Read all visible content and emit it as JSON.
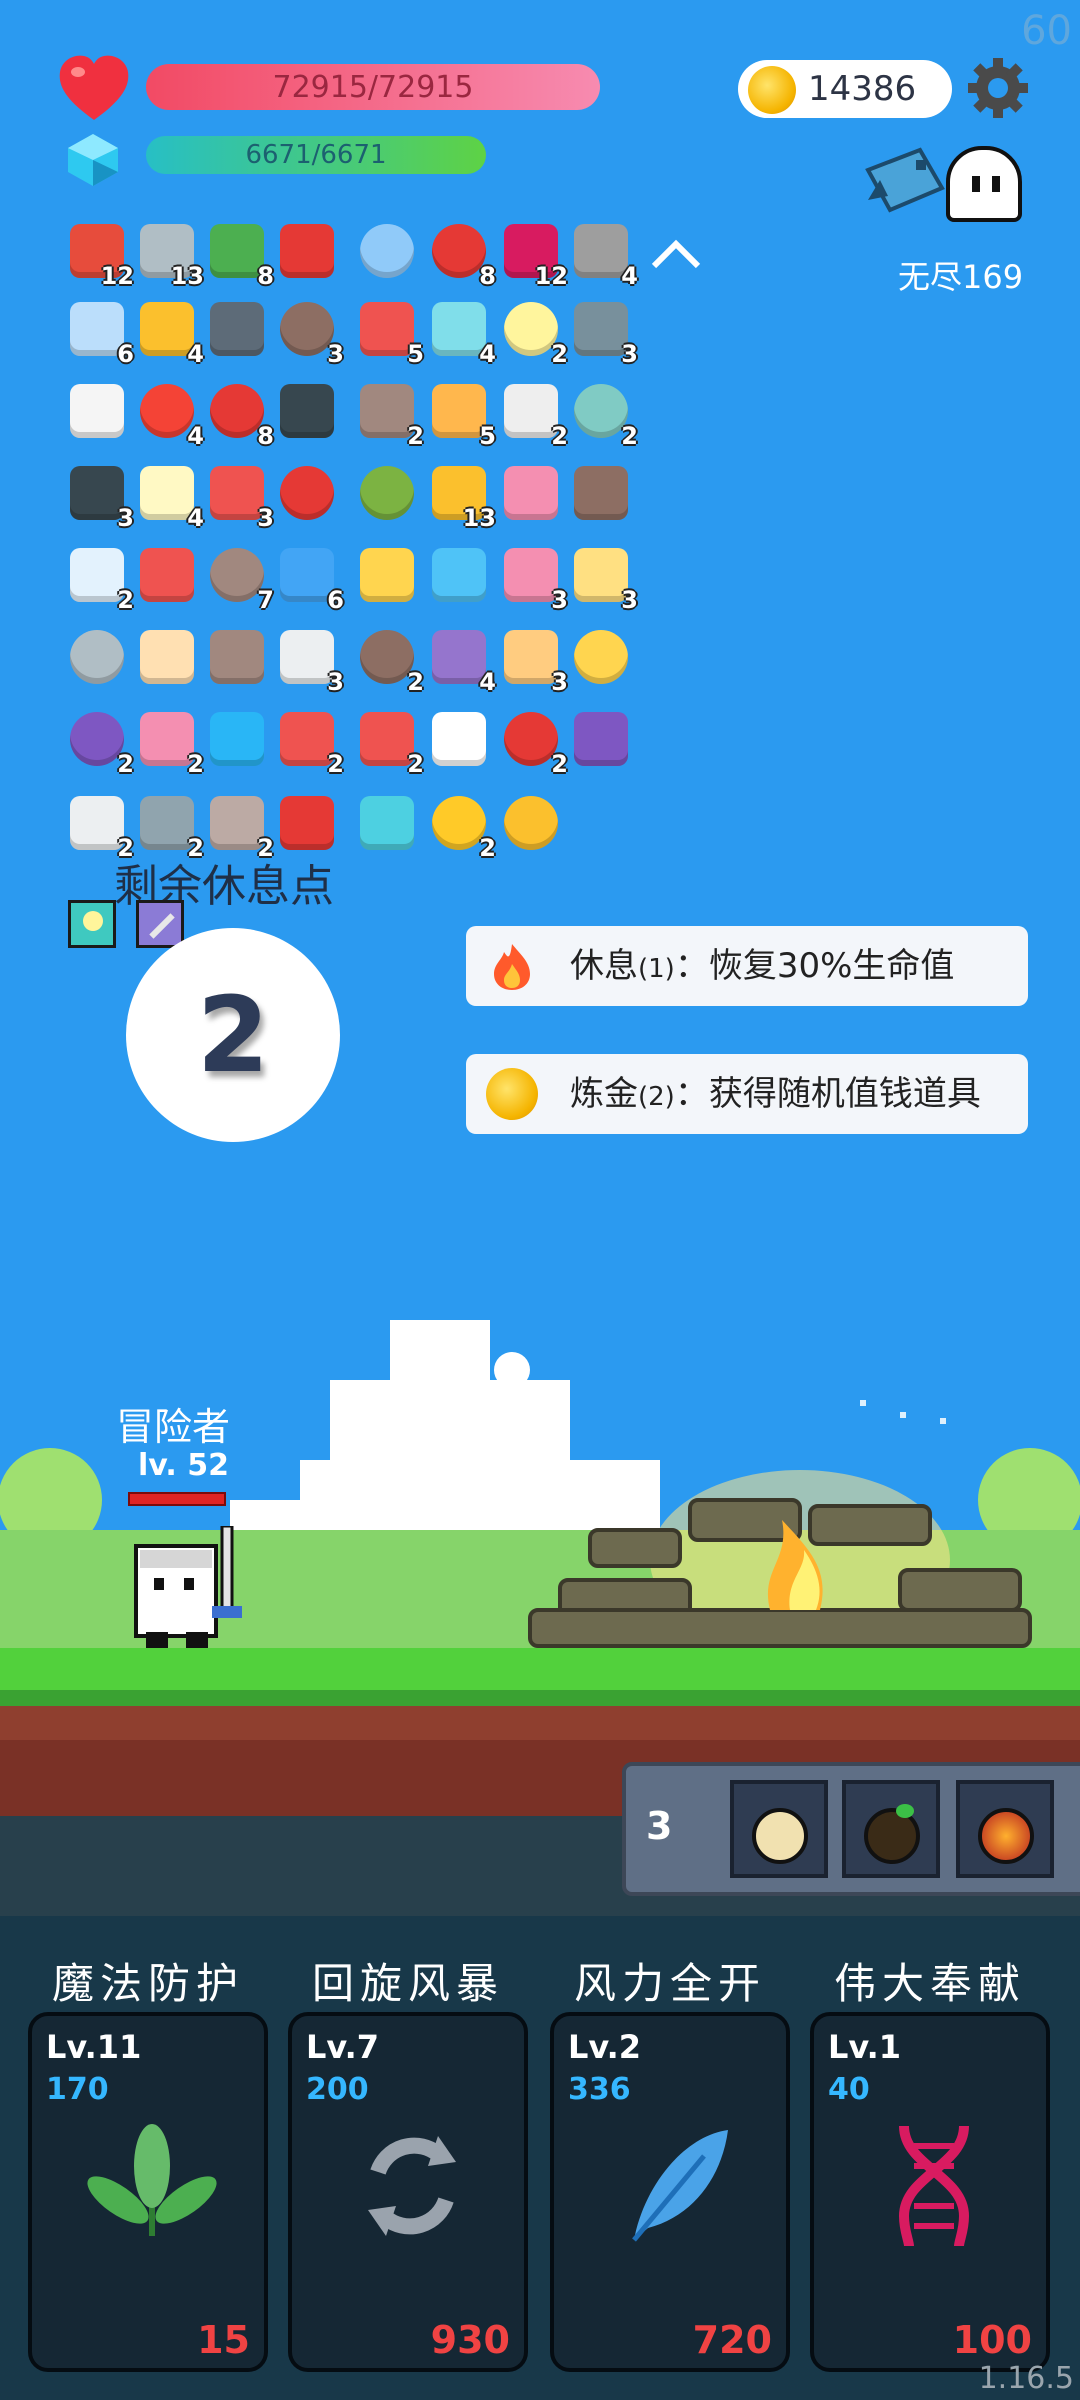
{
  "fps": "60",
  "hp": {
    "text": "72915/72915",
    "fraction": 1.0,
    "color": "#f24a64"
  },
  "mp": {
    "text": "6671/6671",
    "fraction": 1.0,
    "color": "#5ed245"
  },
  "gold": "14386",
  "stage": "无尽169",
  "items": [
    {
      "icon": "sock-icon",
      "count": "12"
    },
    {
      "icon": "sword-icon",
      "count": "13"
    },
    {
      "icon": "money-heart-icon",
      "count": "8"
    },
    {
      "icon": "magnet-icon",
      "count": ""
    },
    {
      "icon": "magnifier-icon",
      "count": ""
    },
    {
      "icon": "strawberry-icon",
      "count": "8"
    },
    {
      "icon": "jam-jar-icon",
      "count": "12"
    },
    {
      "icon": "battle-axe-icon",
      "count": "4"
    },
    {
      "icon": "pill-icon",
      "count": "6"
    },
    {
      "icon": "crown-icon",
      "count": "4"
    },
    {
      "icon": "mortar-icon",
      "count": ""
    },
    {
      "icon": "coconut-icon",
      "count": "3"
    },
    {
      "icon": "watermelon-icon",
      "count": "5"
    },
    {
      "icon": "potion-flask-icon",
      "count": "4"
    },
    {
      "icon": "fried-egg-icon",
      "count": "2"
    },
    {
      "icon": "shield-icon",
      "count": "3"
    },
    {
      "icon": "wing-icon",
      "count": ""
    },
    {
      "icon": "heart-icon",
      "count": "4"
    },
    {
      "icon": "apple-icon",
      "count": "8"
    },
    {
      "icon": "bat-icon",
      "count": ""
    },
    {
      "icon": "tombstone-icon",
      "count": "2"
    },
    {
      "icon": "book-icon",
      "count": "5"
    },
    {
      "icon": "dice-icon",
      "count": "2"
    },
    {
      "icon": "disc-icon",
      "count": "2"
    },
    {
      "icon": "cauldron-icon",
      "count": "3"
    },
    {
      "icon": "lightbulb-icon",
      "count": "4"
    },
    {
      "icon": "capsule-icon",
      "count": "3"
    },
    {
      "icon": "double-heart-icon",
      "count": ""
    },
    {
      "icon": "grenade-icon",
      "count": ""
    },
    {
      "icon": "coin-stack-icon",
      "count": "13"
    },
    {
      "icon": "love-letter-icon",
      "count": ""
    },
    {
      "icon": "treasure-chest-icon",
      "count": ""
    },
    {
      "icon": "clipboard-icon",
      "count": "2"
    },
    {
      "icon": "gift-icon",
      "count": ""
    },
    {
      "icon": "donut-shield-icon",
      "count": "7"
    },
    {
      "icon": "star-card-icon",
      "count": "6"
    },
    {
      "icon": "magic-wand-icon",
      "count": ""
    },
    {
      "icon": "chat-bubble-icon",
      "count": ""
    },
    {
      "icon": "ice-cream-icon",
      "count": "3"
    },
    {
      "icon": "halo-icon",
      "count": "3"
    },
    {
      "icon": "compass-icon",
      "count": ""
    },
    {
      "icon": "scroll-icon",
      "count": ""
    },
    {
      "icon": "bow-icon",
      "count": ""
    },
    {
      "icon": "cloud-icon",
      "count": "3"
    },
    {
      "icon": "cake-icon",
      "count": "2"
    },
    {
      "icon": "star-shield-icon",
      "count": "4"
    },
    {
      "icon": "fist-icon",
      "count": "3"
    },
    {
      "icon": "ring-icon",
      "count": ""
    },
    {
      "icon": "crystal-ball-icon",
      "count": "2"
    },
    {
      "icon": "perfume-icon",
      "count": "2"
    },
    {
      "icon": "gem-icon",
      "count": ""
    },
    {
      "icon": "hook-icon",
      "count": "2"
    },
    {
      "icon": "thermometer-icon",
      "count": "2"
    },
    {
      "icon": "flower-icon",
      "count": ""
    },
    {
      "icon": "mushroom-icon",
      "count": "2"
    },
    {
      "icon": "purple-box-icon",
      "count": ""
    },
    {
      "icon": "envelope-icon",
      "count": "2"
    },
    {
      "icon": "mace-icon",
      "count": "2"
    },
    {
      "icon": "meteor-icon",
      "count": "2"
    },
    {
      "icon": "red-shield-icon",
      "count": ""
    },
    {
      "icon": "blue-scroll-icon",
      "count": ""
    },
    {
      "icon": "sun-icon",
      "count": "2"
    },
    {
      "icon": "sunflower-icon",
      "count": ""
    }
  ],
  "rest": {
    "title": "剩余休息点",
    "points": "2",
    "options": [
      {
        "icon": "fire-icon",
        "name": "休息",
        "num": "(1)",
        "desc": "：恢复30%生命值"
      },
      {
        "icon": "coin-icon",
        "name": "炼金",
        "num": "(2)",
        "desc": "：获得随机值钱道具"
      }
    ]
  },
  "hero": {
    "name": "冒险者",
    "level": "lv. 52",
    "hp_fraction": 1.0
  },
  "potions": {
    "count": "3",
    "slots": [
      "clock-potion-icon",
      "dark-potion-icon",
      "fire-potion-icon"
    ]
  },
  "skills": [
    {
      "name": "魔法防护",
      "level": "Lv.11",
      "power": "170",
      "cost": "15",
      "icon": "leaf-icon"
    },
    {
      "name": "回旋风暴",
      "level": "Lv.7",
      "power": "200",
      "cost": "930",
      "icon": "whirlwind-icon"
    },
    {
      "name": "风力全开",
      "level": "Lv.2",
      "power": "336",
      "cost": "720",
      "icon": "feather-icon"
    },
    {
      "name": "伟大奉献",
      "level": "Lv.1",
      "power": "40",
      "cost": "100",
      "icon": "dna-icon"
    }
  ],
  "version": "1.16.5"
}
